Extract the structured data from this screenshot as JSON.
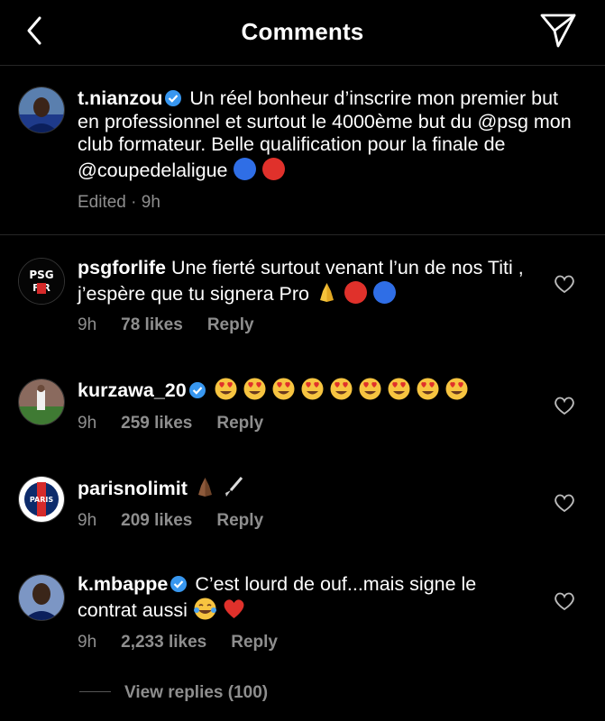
{
  "header": {
    "title": "Comments"
  },
  "caption": {
    "username": "t.nianzou",
    "text": "Un réel bonheur d’inscrire mon premier but en professionnel et surtout le 4000ème but du @psg mon club formateur. Belle qualification pour la finale de @coupedelaligue",
    "meta": "Edited · 9h"
  },
  "comments": [
    {
      "username": "psgforlife",
      "text": "Une fierté surtout venant l’un de nos Titi , j’espère que tu signera Pro",
      "time": "9h",
      "likes": "78 likes",
      "reply": "Reply",
      "icons": [
        "praying-hands-icon",
        "red-circle-icon",
        "blue-circle-icon"
      ]
    },
    {
      "username": "kurzawa_20",
      "text": "",
      "time": "9h",
      "likes": "259 likes",
      "reply": "Reply",
      "icons": [
        "heart-eyes-icon x9"
      ]
    },
    {
      "username": "parisnolimit",
      "text": "",
      "time": "9h",
      "likes": "209 likes",
      "reply": "Reply",
      "icons": [
        "praying-hands-icon",
        "paintbrush-icon"
      ]
    },
    {
      "username": "k.mbappe",
      "text_line1": "C’est lourd de ouf...mais signe le",
      "text_line2": "contrat aussi",
      "time": "9h",
      "likes": "2,233 likes",
      "reply": "Reply",
      "icons": [
        "tears-of-joy-icon",
        "red-heart-icon"
      ]
    }
  ],
  "view_replies": "View replies (100)",
  "colors": {
    "background": "#000000",
    "muted": "#8e8e8e",
    "divider": "#262626",
    "verified": "#3897f0"
  }
}
